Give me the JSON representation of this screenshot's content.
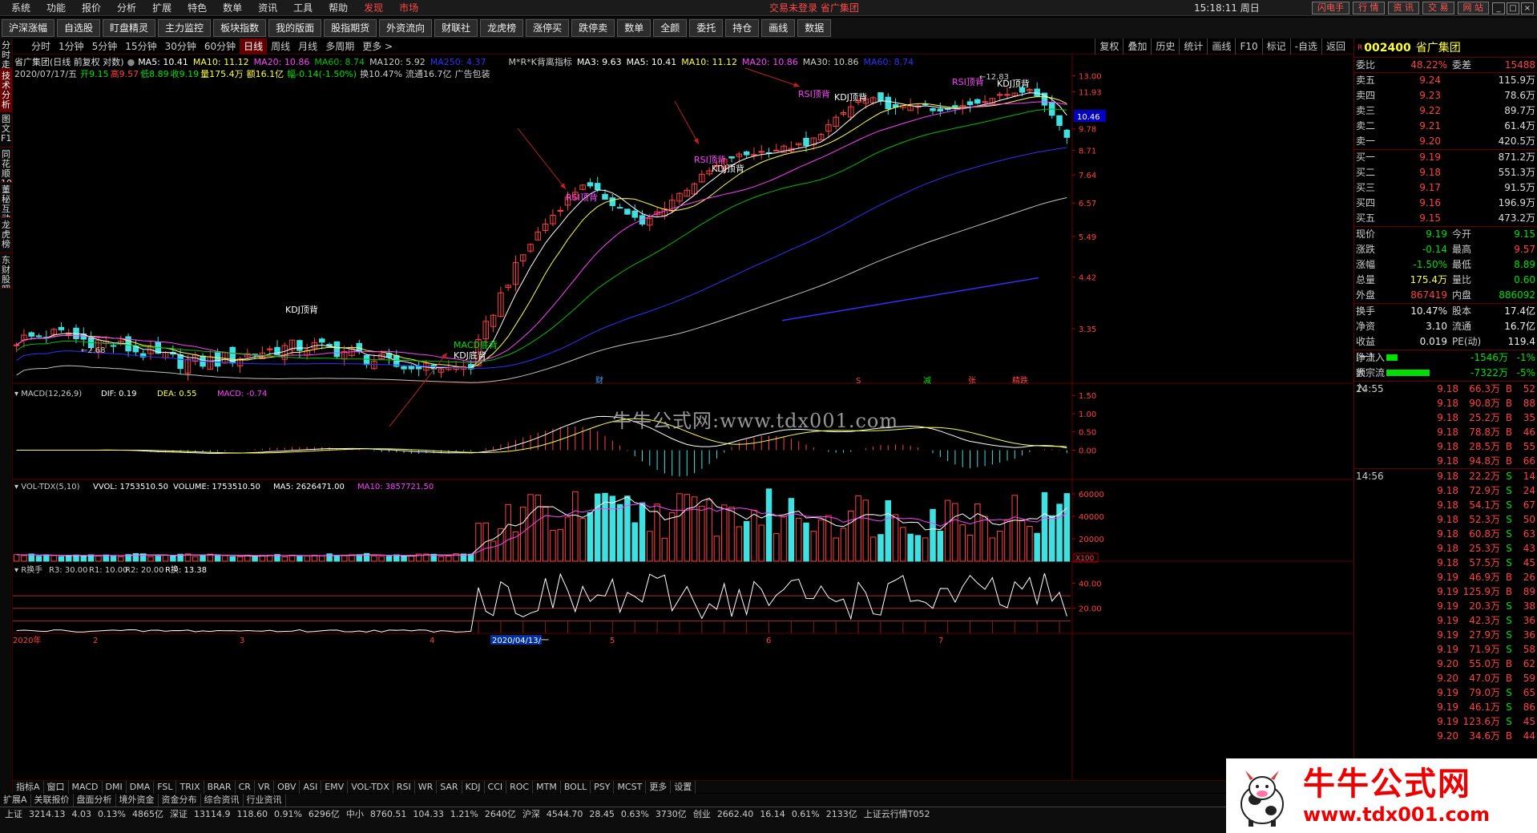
{
  "menu": {
    "items": [
      "系统",
      "功能",
      "报价",
      "分析",
      "扩展",
      "特色",
      "数单",
      "资讯",
      "工具",
      "帮助"
    ],
    "red_items": [
      "发现",
      "市场"
    ],
    "center_status": "交易未登录  省广集团",
    "clock": "15:18:11 周日",
    "right_buttons": [
      "闪电手",
      "行 情",
      "资 讯",
      "交 易",
      "网 站"
    ]
  },
  "toolbar": {
    "items": [
      "沪深涨幅",
      "自选股",
      "盯盘精灵",
      "主力监控",
      "板块指数",
      "我的版面",
      "股指期货",
      "外资流向",
      "财联社",
      "龙虎榜",
      "涨停买",
      "跌停卖",
      "数单",
      "全颜",
      "委托",
      "持仓",
      "画线",
      "数据"
    ]
  },
  "left_side": [
    "分时走势",
    "技术分析",
    "图文F10",
    "同花顺10",
    "董秘互动",
    "龙虎榜",
    "东财股吧"
  ],
  "periods": {
    "items": [
      "分时",
      "1分钟",
      "5分钟",
      "15分钟",
      "30分钟",
      "60分钟",
      "日线",
      "周线",
      "月线",
      "多周期",
      "更多 >"
    ],
    "active": "日线",
    "right_items": [
      "复权",
      "叠加",
      "历史",
      "统计",
      "画线",
      "F10",
      "标记",
      "-自选",
      "返回"
    ]
  },
  "chart_header": {
    "title": "省广集团(日线 前复权 对数)",
    "ma5": "MA5: 10.41",
    "ma10": "MA10: 11.12",
    "ma20": "MA20: 10.86",
    "ma60": "MA60: 8.74",
    "ma120": "MA120: 5.92",
    "ma250": "MA250: 4.37",
    "indicator": "M*R*K背离指标",
    "ma3b": "MA3: 9.63",
    "ma5b": "MA5: 10.41",
    "ma10b": "MA10: 11.12",
    "ma20b": "MA20: 10.86",
    "ma30b": "MA30: 10.86",
    "ma60b": "MA60: 8.74",
    "line2_date": "2020/07/17/五",
    "line2_open": "开9.15",
    "line2_high": "高9.57",
    "line2_low": "低8.89",
    "line2_close": "收9.19",
    "line2_vol": "量175.4万",
    "line2_amt": "额16.1亿",
    "line2_chg": "幅-0.14(-1.50%)",
    "line2_turn": "换10.47%",
    "line2_float": "流通16.7亿",
    "line2_ad": "广告包装"
  },
  "price_axis": [
    "13.00",
    "11.93",
    "10.46",
    "9.78",
    "8.71",
    "7.64",
    "6.57",
    "5.49",
    "4.42",
    "3.35"
  ],
  "current_price_tag": "10.46",
  "annotations": {
    "kdj_top1": "KDJ顶背",
    "rsi_top1": "RSI顶背",
    "rsi_top2": "RSI顶背",
    "kdj_top2": "KDJ顶背",
    "rsi_top3": "RSI顶背",
    "kdj_top3": "KDJ顶背",
    "rsi_top4": "RSI顶背",
    "kdj_top4": "KDJ顶背",
    "macd_bottom": "MACD底背",
    "kdj_bottom": "KDJ底背",
    "low_mark": "2.68",
    "high_mark": "12.83",
    "flags": [
      "财",
      "S",
      "减",
      "张",
      "精跌"
    ]
  },
  "macd": {
    "header": "MACD(12,26,9)",
    "dif": "DIF: 0.19",
    "dea": "DEA: 0.55",
    "macd": "MACD: -0.74",
    "axis": [
      "1.50",
      "1.00",
      "0.50",
      "0.00"
    ]
  },
  "vol": {
    "header": "VOL-TDX(5,10)",
    "vvol": "VVOL: 1753510.50",
    "volume": "VOLUME: 1753510.50",
    "ma5": "MA5: 2626471.00",
    "ma10": "MA10: 3857721.50",
    "axis": [
      "60000",
      "40000",
      "20000"
    ],
    "unit": "X100"
  },
  "turnover": {
    "header": "R换手",
    "r3": "R3: 30.00",
    "r1": "R1: 10.00",
    "r2": "R2: 20.00",
    "rt": "R换: 13.38",
    "axis": [
      "40.00",
      "20.00"
    ]
  },
  "time_axis": [
    "2020年",
    "2",
    "3",
    "4",
    "2020/04/13/一",
    "5",
    "6",
    "7"
  ],
  "bottom_tabs": [
    "指标A",
    "窗口",
    "MACD",
    "DMI",
    "DMA",
    "FSL",
    "TRIX",
    "BRAR",
    "CR",
    "VR",
    "OBV",
    "ASI",
    "EMV",
    "VOL-TDX",
    "RSI",
    "WR",
    "SAR",
    "KDJ",
    "CCI",
    "ROC",
    "MTM",
    "BOLL",
    "PSY",
    "MCST",
    "更多",
    "设置"
  ],
  "bottom_tabs2": [
    "扩展A",
    "关联报价",
    "盘面分析",
    "境外资金",
    "资金分布",
    "综合资讯",
    "行业资讯"
  ],
  "statusbar": {
    "sh_label": "上证",
    "sh_val": "3214.13",
    "sh_chg": "4.03",
    "sh_pct": "0.13%",
    "sh_amt": "4865亿",
    "sz_label": "深证",
    "sz_val": "13114.9",
    "sz_chg": "118.60",
    "sz_pct": "0.91%",
    "sz_amt": "6296亿",
    "zx_label": "中小",
    "zx_val": "8760.51",
    "zx_chg": "104.33",
    "zx_pct": "1.21%",
    "zx_amt": "2640亿",
    "hs_label": "沪深",
    "hs_val": "4544.70",
    "hs_chg": "28.45",
    "hs_pct": "0.63%",
    "hs_amt": "3730亿",
    "cy_label": "创业",
    "cy_val": "2662.40",
    "cy_chg": "16.14",
    "cy_pct": "0.61%",
    "cy_amt": "2133亿",
    "news": "上证云行情T052"
  },
  "stock": {
    "code": "002400",
    "name": "省广集团",
    "r_mark": "R",
    "weibi_label": "委比",
    "weibi": "48.22%",
    "weicha_label": "委差",
    "weicha": "15488"
  },
  "asks": [
    {
      "label": "卖五",
      "price": "9.24",
      "vol": "115.9万",
      "sym": "¥"
    },
    {
      "label": "卖四",
      "price": "9.23",
      "vol": "78.6万"
    },
    {
      "label": "卖三",
      "price": "9.22",
      "vol": "89.7万"
    },
    {
      "label": "卖二",
      "price": "9.21",
      "vol": "61.4万"
    },
    {
      "label": "卖一",
      "price": "9.20",
      "vol": "420.5万"
    }
  ],
  "bids": [
    {
      "label": "买一",
      "price": "9.19",
      "vol": "871.2万"
    },
    {
      "label": "买二",
      "price": "9.18",
      "vol": "551.3万"
    },
    {
      "label": "买三",
      "price": "9.17",
      "vol": "91.5万"
    },
    {
      "label": "买四",
      "price": "9.16",
      "vol": "196.9万"
    },
    {
      "label": "买五",
      "price": "9.15",
      "vol": "473.2万"
    }
  ],
  "quote": [
    {
      "k": "现价",
      "v": "9.19",
      "vc": "grn",
      "k2": "今开",
      "v2": "9.15",
      "v2c": "grn"
    },
    {
      "k": "涨跌",
      "v": "-0.14",
      "vc": "grn",
      "k2": "最高",
      "v2": "9.57",
      "v2c": "red"
    },
    {
      "k": "涨幅",
      "v": "-1.50%",
      "vc": "grn",
      "k2": "最低",
      "v2": "8.89",
      "v2c": "grn"
    },
    {
      "k": "总量",
      "v": "175.4万",
      "vc": "yel",
      "k2": "量比",
      "v2": "0.60",
      "v2c": "grn"
    },
    {
      "k": "外盘",
      "v": "867419",
      "vc": "red",
      "k2": "内盘",
      "v2": "886092",
      "v2c": "grn"
    }
  ],
  "quote2": [
    {
      "k": "换手",
      "v": "10.47%",
      "vc": "wht",
      "k2": "股本",
      "v2": "17.4亿",
      "v2c": "wht"
    },
    {
      "k": "净资",
      "v": "3.10",
      "vc": "wht",
      "k2": "流通",
      "v2": "16.7亿",
      "v2c": "wht"
    },
    {
      "k": "收益(一)",
      "v": "0.019",
      "vc": "wht",
      "k2": "PE(动)",
      "v2": "119.4",
      "v2c": "wht"
    }
  ],
  "flows": [
    {
      "k": "净流入额",
      "v": "-1546万",
      "p": "-1%"
    },
    {
      "k": "大宗流入",
      "v": "-7322万",
      "p": "-5%"
    }
  ],
  "ticks_1": {
    "time": "14:55",
    "rows": [
      {
        "p": "9.18",
        "v": "66.3万",
        "d": "B",
        "n": "52"
      },
      {
        "p": "9.18",
        "v": "90.8万",
        "d": "B",
        "n": "88"
      },
      {
        "p": "9.18",
        "v": "25.2万",
        "d": "B",
        "n": "35"
      },
      {
        "p": "9.18",
        "v": "78.8万",
        "d": "B",
        "n": "46"
      },
      {
        "p": "9.18",
        "v": "28.5万",
        "d": "B",
        "n": "55"
      },
      {
        "p": "9.18",
        "v": "94.8万",
        "d": "B",
        "n": "66"
      }
    ]
  },
  "ticks_2": {
    "time": "14:56",
    "rows": [
      {
        "p": "9.18",
        "v": "22.2万",
        "d": "S",
        "n": "14"
      },
      {
        "p": "9.18",
        "v": "72.9万",
        "d": "S",
        "n": "24"
      },
      {
        "p": "9.18",
        "v": "54.1万",
        "d": "S",
        "n": "67"
      },
      {
        "p": "9.18",
        "v": "52.3万",
        "d": "S",
        "n": "50"
      },
      {
        "p": "9.18",
        "v": "60.8万",
        "d": "S",
        "n": "63"
      },
      {
        "p": "9.18",
        "v": "25.3万",
        "d": "S",
        "n": "43"
      },
      {
        "p": "9.18",
        "v": "57.5万",
        "d": "S",
        "n": "45"
      },
      {
        "p": "9.19",
        "v": "46.9万",
        "d": "B",
        "n": "26"
      },
      {
        "p": "9.19",
        "v": "125.9万",
        "d": "B",
        "n": "89"
      },
      {
        "p": "9.19",
        "v": "20.3万",
        "d": "S",
        "n": "38"
      },
      {
        "p": "9.19",
        "v": "42.3万",
        "d": "S",
        "n": "36"
      },
      {
        "p": "9.19",
        "v": "27.9万",
        "d": "S",
        "n": "36"
      },
      {
        "p": "9.19",
        "v": "71.9万",
        "d": "S",
        "n": "58"
      },
      {
        "p": "9.20",
        "v": "55.0万",
        "d": "B",
        "n": "62"
      },
      {
        "p": "9.20",
        "v": "47.0万",
        "d": "B",
        "n": "59"
      },
      {
        "p": "9.19",
        "v": "79.0万",
        "d": "S",
        "n": "65"
      },
      {
        "p": "9.19",
        "v": "46.1万",
        "d": "S",
        "n": "86"
      },
      {
        "p": "9.19",
        "v": "123.6万",
        "d": "S",
        "n": "45"
      },
      {
        "p": "9.20",
        "v": "34.6万",
        "d": "B",
        "n": "44"
      }
    ]
  },
  "watermark": {
    "center": "牛牛公式网:www.tdx001.com",
    "logo_title": "牛牛公式网",
    "logo_url": "www.tdx001.com"
  },
  "colors": {
    "up": "#ff4040",
    "down": "#40e0e0",
    "ma5": "#ffffff",
    "ma10": "#ffff40",
    "ma20": "#ff40ff",
    "ma60": "#00c000",
    "ma120": "#c0c0c0",
    "ma250": "#3030ff"
  }
}
